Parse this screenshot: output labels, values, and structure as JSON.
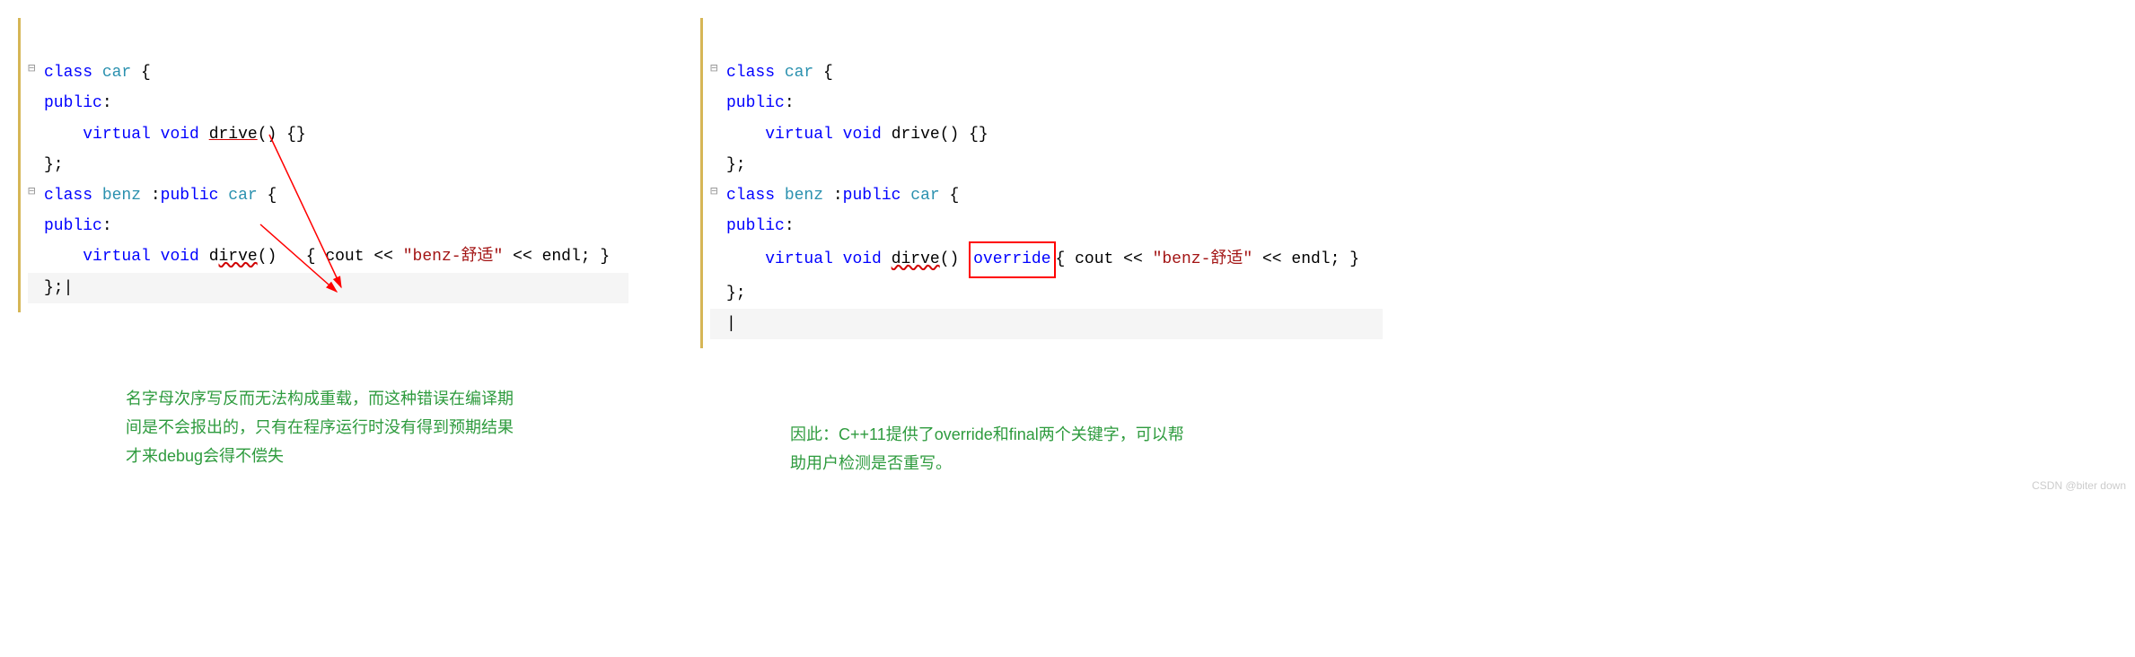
{
  "left": {
    "code": {
      "kw_class1": "class",
      "type_car1": "car",
      "brace_open1": " {",
      "kw_public1": "public",
      "colon1": ":",
      "kw_virtual1": "virtual",
      "kw_void1": "void",
      "fn_drive": "drive",
      "fn_drive_tail": "() {}",
      "close1": "};",
      "kw_class2": "class",
      "type_benz": "benz",
      "inherit": " :",
      "kw_public_inh": "public",
      "type_car2": "car",
      "brace_open2": " {",
      "kw_public2": "public",
      "colon2": ":",
      "kw_virtual2": "virtual",
      "kw_void2": "void",
      "fn_dirve": "dirve",
      "fn_dirve_tail": "()   { cout << ",
      "str_benz": "\"benz-舒适\"",
      "endl": " << endl; }",
      "close2": "};",
      "cursor": "|"
    },
    "annotation": {
      "line1": "名字母次序写反而无法构成重载，而这种错误在编译期",
      "line2": "间是不会报出的，只有在程序运行时没有得到预期结果",
      "line3": "才来debug会得不偿失"
    }
  },
  "right": {
    "code": {
      "kw_class1": "class",
      "type_car1": "car",
      "brace_open1": " {",
      "kw_public1": "public",
      "colon1": ":",
      "kw_virtual1": "virtual",
      "kw_void1": "void",
      "fn_drive": "drive() {}",
      "close1": "};",
      "kw_class2": "class",
      "type_benz": "benz",
      "inherit": " :",
      "kw_public_inh": "public",
      "type_car2": "car",
      "brace_open2": " {",
      "kw_public2": "public",
      "colon2": ":",
      "kw_virtual2": "virtual",
      "kw_void2": "void",
      "fn_dirve": "dirve",
      "fn_dirve_tail": "() ",
      "kw_override": "override",
      "after_override": "{ cout << ",
      "str_benz": "\"benz-舒适\"",
      "endl": " << endl; }",
      "close2": "};",
      "cursor": "|"
    },
    "annotation": {
      "line1": "因此：C++11提供了override和final两个关键字，可以帮",
      "line2": "助用户检测是否重写。"
    }
  },
  "watermark": "CSDN @biter down"
}
